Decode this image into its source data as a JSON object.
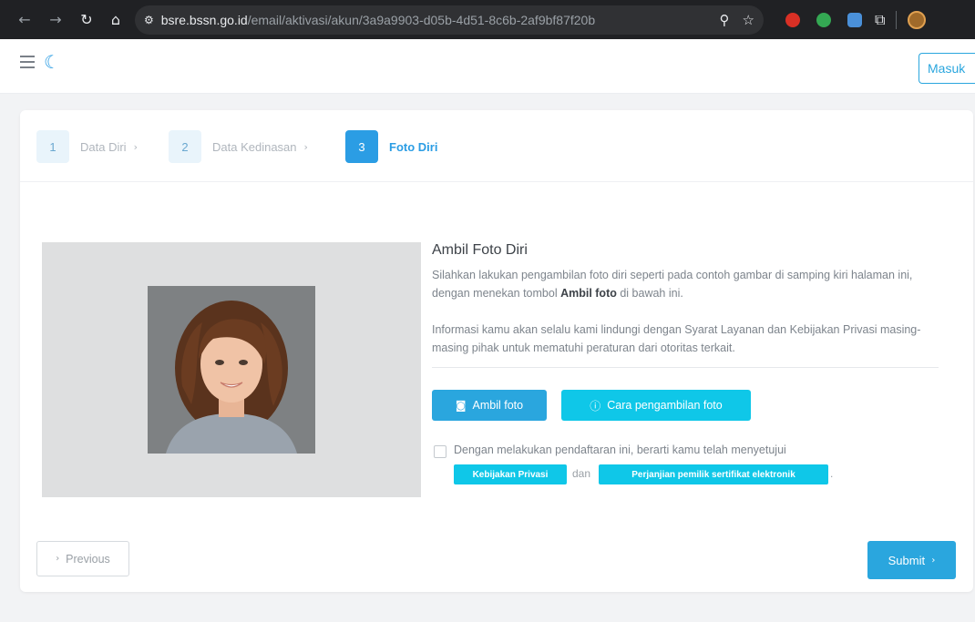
{
  "browser": {
    "url_host": "bsre.bssn.go.id",
    "url_path": "/email/aktivasi/akun/3a9a9903-d05b-4d51-8c6b-2af9bf87f20b",
    "icons": [
      "back-arrow-icon",
      "forward-arrow-icon",
      "reload-icon",
      "home-icon",
      "site-info-icon",
      "zoom-icon",
      "bookmark-star-icon",
      "extensions-puzzle-icon"
    ]
  },
  "header": {
    "login_label": "Masuk"
  },
  "stepper": {
    "steps": [
      {
        "number": "1",
        "label": "Data Diri",
        "active": false
      },
      {
        "number": "2",
        "label": "Data Kedinasan",
        "active": false
      },
      {
        "number": "3",
        "label": "Foto Diri",
        "active": true
      }
    ]
  },
  "main": {
    "title": "Ambil Foto Diri",
    "instruction_before": "Silahkan lakukan pengambilan foto diri seperti pada contoh gambar di samping kiri halaman ini, dengan menekan tombol ",
    "instruction_bold": "Ambil foto",
    "instruction_after": " di bawah ini.",
    "privacy_text": "Informasi kamu akan selalu kami lindungi dengan Syarat Layanan dan Kebijakan Privasi masing-masing pihak untuk mematuhi peraturan dari otoritas terkait.",
    "take_photo_label": "Ambil foto",
    "how_to_label": "Cara pengambilan foto",
    "agree_text": "Dengan melakukan pendaftaran ini, berarti kamu telah menyetujui",
    "privacy_policy_label": "Kebijakan Privasi",
    "and_label": "dan",
    "agreement_label": "Perjanjian pemilik sertifikat elektronik",
    "trailing_period": "."
  },
  "footer": {
    "previous_label": "Previous",
    "submit_label": "Submit"
  },
  "colors": {
    "primary": "#2aa6de",
    "cyan": "#0fc7e8",
    "step_active": "#2b9de4"
  }
}
